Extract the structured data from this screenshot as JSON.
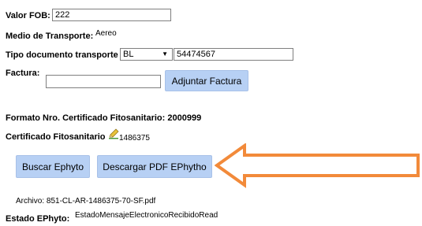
{
  "valor_fob": {
    "label": "Valor FOB:",
    "value": "222"
  },
  "medio_transporte": {
    "label": "Medio de Transporte:",
    "value": "Aereo"
  },
  "tipo_documento": {
    "label": "Tipo documento transporte",
    "selected": "BL",
    "number": "54474567"
  },
  "factura": {
    "label": "Factura:",
    "value": "",
    "button_label": "Adjuntar Factura"
  },
  "formato": {
    "label": "Formato Nro. Certificado Fitosanitario:",
    "value": "2000999"
  },
  "certificado": {
    "label": "Certificado Fitosanitario",
    "icon": "edit-pencil-icon",
    "value": "1486375"
  },
  "buttons": {
    "buscar": "Buscar Ephyto",
    "descargar": "Descargar PDF EPhytho"
  },
  "archivo": {
    "label": "Archivo:",
    "value": "851-CL-AR-1486375-70-SF.pdf"
  },
  "estado": {
    "label": "Estado EPhyto:",
    "value": "EstadoMensajeElectronicoRecibidoRead"
  },
  "annotation": {
    "arrow_color": "#f28a3a",
    "button_color": "#b7d0f4"
  }
}
